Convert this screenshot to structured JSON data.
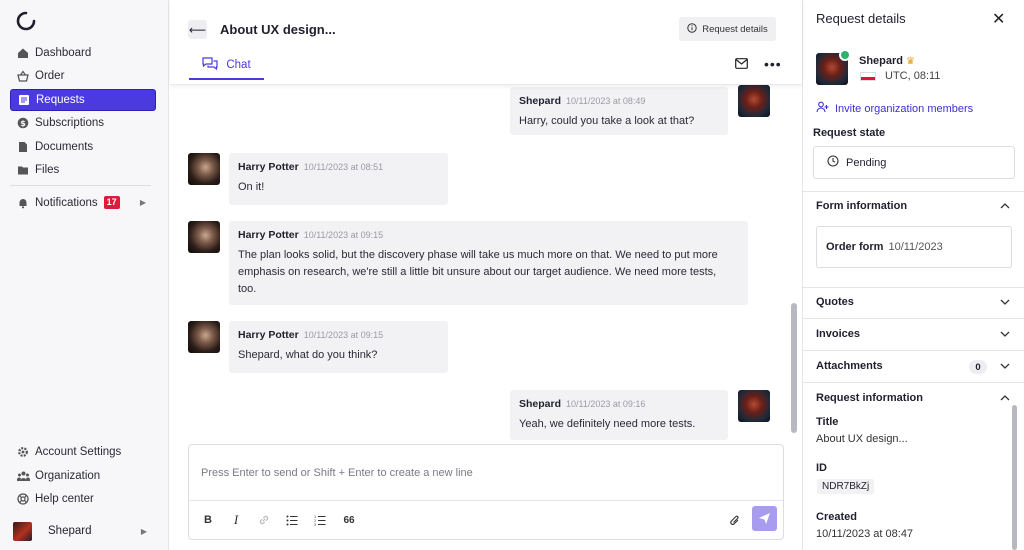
{
  "sidebar": {
    "items": [
      {
        "label": "Dashboard",
        "icon": "home-icon"
      },
      {
        "label": "Order",
        "icon": "basket-icon"
      },
      {
        "label": "Requests",
        "icon": "requests-icon",
        "active": true
      },
      {
        "label": "Subscriptions",
        "icon": "dollar-icon"
      },
      {
        "label": "Documents",
        "icon": "document-icon"
      },
      {
        "label": "Files",
        "icon": "folder-icon"
      }
    ],
    "notifications": {
      "label": "Notifications",
      "count": "17"
    },
    "bottom_items": [
      {
        "label": "Account Settings",
        "icon": "gear-icon"
      },
      {
        "label": "Organization",
        "icon": "people-icon"
      },
      {
        "label": "Help center",
        "icon": "help-icon"
      }
    ],
    "user": {
      "name": "Shepard"
    }
  },
  "header": {
    "title": "About UX design...",
    "request_details_label": "Request details",
    "tab_chat_label": "Chat"
  },
  "messages": [
    {
      "author": "Shepard",
      "time": "10/11/2023 at 08:49",
      "text": "Harry, could you take a look at that?",
      "side": "right"
    },
    {
      "author": "Harry Potter",
      "time": "10/11/2023 at 08:51",
      "text": "On it!",
      "side": "left"
    },
    {
      "author": "Harry Potter",
      "time": "10/11/2023 at 09:15",
      "text": "The plan looks solid, but the discovery phase will take us much more on that. We need to put more emphasis on research, we're still a little bit unsure about our target audience. We need more tests, too.",
      "side": "left"
    },
    {
      "author": "Harry Potter",
      "time": "10/11/2023 at 09:15",
      "text": "Shepard, what do you think?",
      "side": "left"
    },
    {
      "author": "Shepard",
      "time": "10/11/2023 at 09:16",
      "text": "Yeah, we definitely need more tests.",
      "side": "right"
    }
  ],
  "composer": {
    "placeholder": "Press Enter to send or Shift + Enter to create a new line",
    "quote_label": "66"
  },
  "panel": {
    "title": "Request details",
    "user_name": "Shepard",
    "timezone": "UTC, 08:11",
    "invite_label": "Invite organization members",
    "state_label": "Request state",
    "state_value": "Pending",
    "form_section": "Form information",
    "form_label": "Order form",
    "form_date": "10/11/2023",
    "quotes_label": "Quotes",
    "invoices_label": "Invoices",
    "attachments_label": "Attachments",
    "attachments_count": "0",
    "request_info_label": "Request information",
    "title_label": "Title",
    "title_value": "About UX design...",
    "id_label": "ID",
    "id_value": "NDR7BkZj",
    "created_label": "Created",
    "created_value": "10/11/2023 at 08:47"
  },
  "colors": {
    "accent": "#4a3ae0",
    "badge": "#d91c3a",
    "online": "#2bb36b"
  }
}
